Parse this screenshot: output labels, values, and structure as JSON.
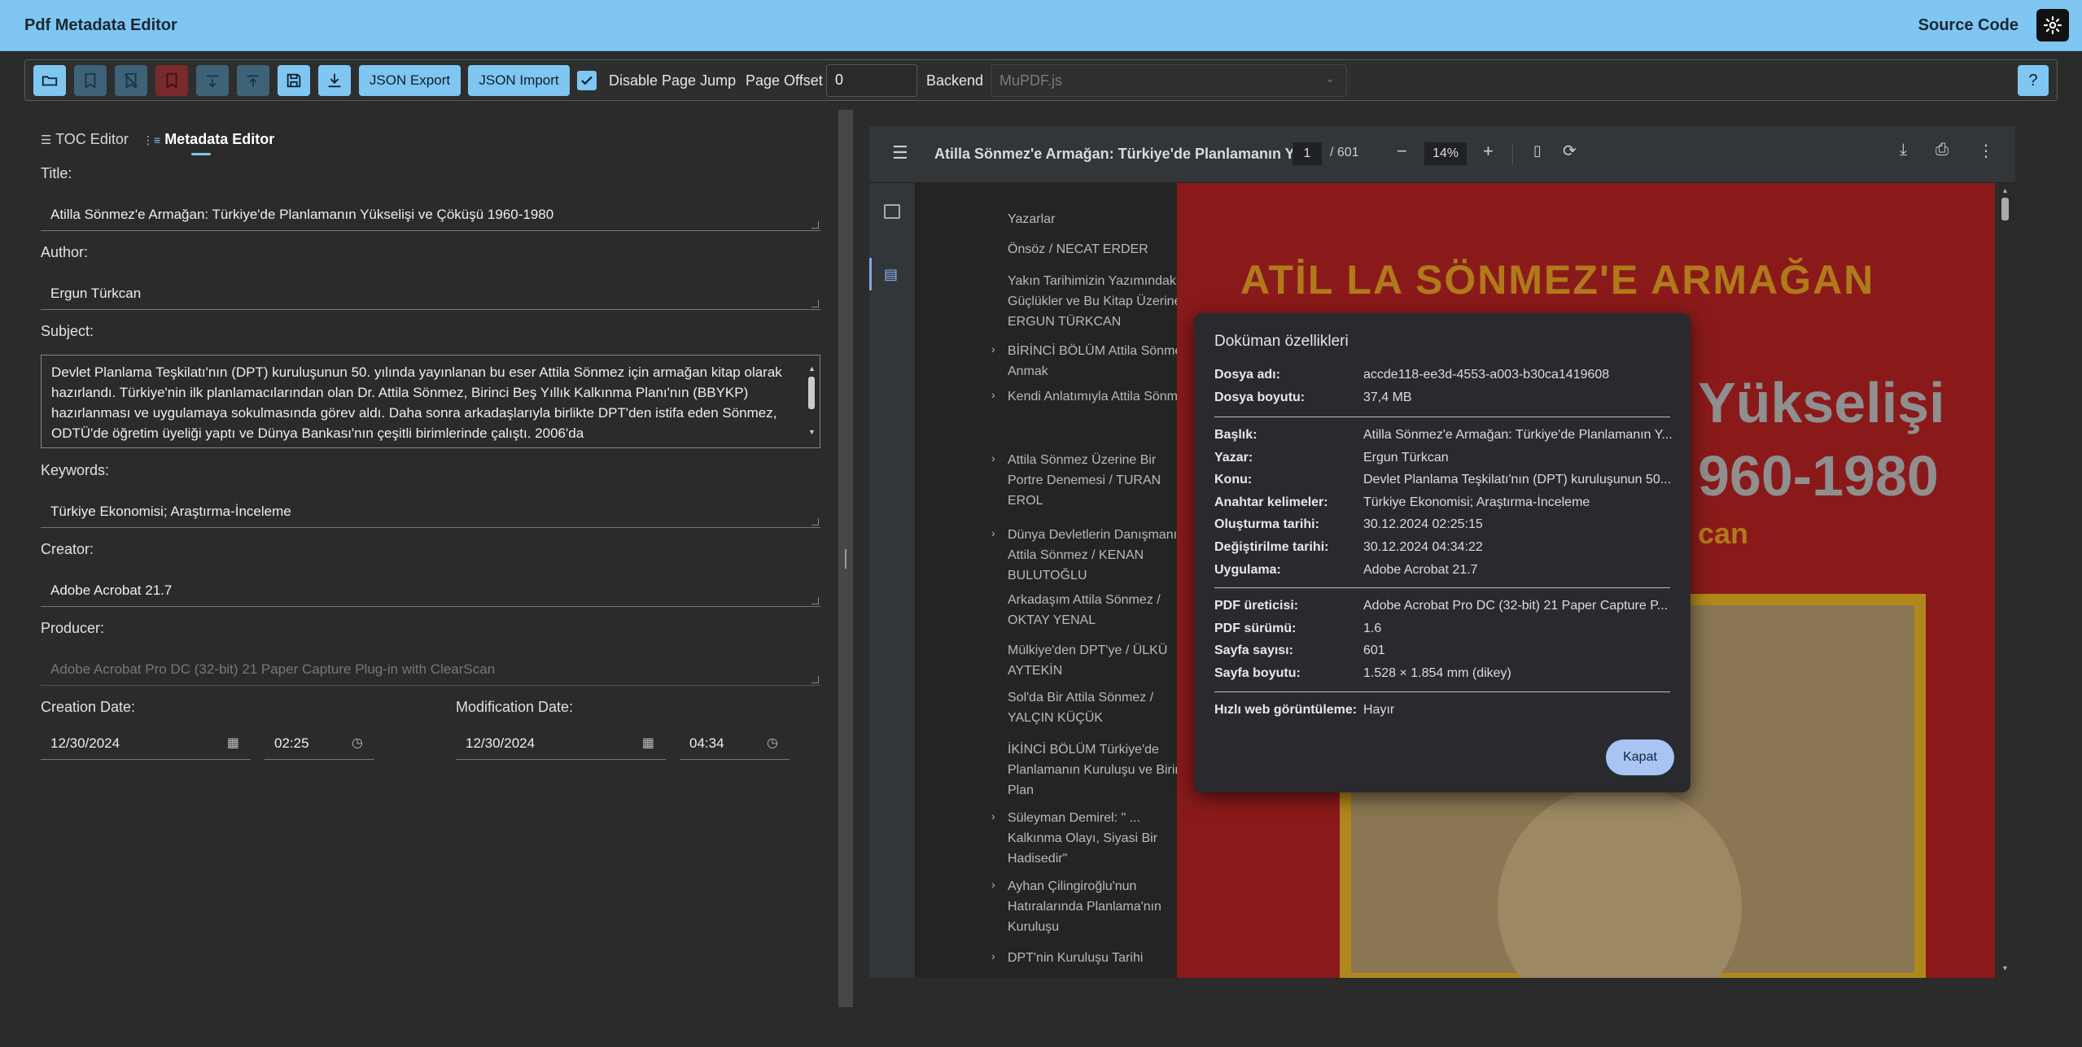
{
  "app": {
    "title": "Pdf Metadata Editor",
    "source_code": "Source Code"
  },
  "toolbar": {
    "json_export": "JSON Export",
    "json_import": "JSON Import",
    "disable_page_jump": "Disable Page Jump",
    "page_offset_label": "Page Offset",
    "page_offset_value": "0",
    "backend_label": "Backend",
    "backend_value": "MuPDF.js",
    "help": "?"
  },
  "tabs": {
    "toc": "TOC Editor",
    "metadata": "Metadata Editor"
  },
  "form": {
    "title_label": "Title:",
    "title_value": "Atilla Sönmez'e Armağan: Türkiye'de Planlamanın Yükselişi ve Çöküşü 1960-1980",
    "author_label": "Author:",
    "author_value": "Ergun Türkcan",
    "subject_label": "Subject:",
    "subject_value": "Devlet Planlama Teşkilatı'nın (DPT) kuruluşunun 50. yılında yayınlanan bu eser Attila Sönmez için armağan kitap olarak hazırlandı. Türkiye'nin ilk planlamacılarından olan Dr. Attila Sönmez, Birinci Beş Yıllık Kalkınma Planı'nın (BBYKP) hazırlanması ve uygulamaya sokulmasında görev aldı. Daha sonra arkadaşlarıyla birlikte DPT'den istifa eden Sönmez, ODTÜ'de öğretim üyeliği yaptı ve Dünya Bankası'nın çeşitli birimlerinde çalıştı. 2006'da",
    "keywords_label": "Keywords:",
    "keywords_value": "Türkiye Ekonomisi; Araştırma-İnceleme",
    "creator_label": "Creator:",
    "creator_value": "Adobe Acrobat 21.7",
    "producer_label": "Producer:",
    "producer_value": "Adobe Acrobat Pro DC (32-bit) 21 Paper Capture Plug-in with ClearScan",
    "creation_label": "Creation Date:",
    "creation_date": "12/30/2024",
    "creation_time": "02:25",
    "modification_label": "Modification Date:",
    "modification_date": "12/30/2024",
    "modification_time": "04:34"
  },
  "viewer": {
    "title": "Atilla Sönmez'e Armağan: Türkiye'de Planlamanın Y...",
    "page": "1",
    "total": "/ 601",
    "zoom": "14%",
    "outline": [
      {
        "label": "Yazarlar",
        "chevron": false
      },
      {
        "label": "Önsöz / NECAT ERDER",
        "chevron": false
      },
      {
        "label": "Yakın Tarihimizin Yazımındaki Güçlükler ve Bu Kitap Üzerine / ERGUN TÜRKCAN",
        "chevron": false
      },
      {
        "label": "BİRİNCİ BÖLÜM Attila Sönmez'i Anmak",
        "chevron": true
      },
      {
        "label": "Kendi Anlatımıyla Attila Sönmez",
        "chevron": true
      },
      {
        "label": "Attila Sönmez Üzerine Bir Portre Denemesi / TURAN EROL",
        "chevron": true
      },
      {
        "label": "Dünya Devletlerin Danışmanı: Attila Sönmez / KENAN BULUTOĞLU",
        "chevron": true
      },
      {
        "label": "Arkadaşım Attila Sönmez / OKTAY YENAL",
        "chevron": false
      },
      {
        "label": "Mülkiye'den DPT'ye / ÜLKÜ AYTEKİN",
        "chevron": false
      },
      {
        "label": "Sol'da Bir Attila Sönmez / YALÇIN KÜÇÜK",
        "chevron": false
      },
      {
        "label": "İKİNCİ BÖLÜM Türkiye'de Planlamanın Kuruluşu ve Birinci Plan",
        "chevron": false
      },
      {
        "label": "Süleyman Demirel: \" ... Kalkınma Olayı, Siyasi Bir Hadisedir\"",
        "chevron": true
      },
      {
        "label": "Ayhan Çilingiroğlu'nun Hatıralarında Planlama'nın Kuruluşu",
        "chevron": true
      },
      {
        "label": "DPT'nin Kuruluşu Tarihi",
        "chevron": true
      }
    ],
    "pdf_title": "ATİL LA SÖNMEZ'E ARMAĞAN",
    "pdf_word1": "Yükselişi",
    "pdf_word2": "960-1980",
    "pdf_word3": "can"
  },
  "dialog": {
    "title": "Doküman özellikleri",
    "group1": [
      {
        "k": "Dosya adı:",
        "v": "accde118-ee3d-4553-a003-b30ca1419608"
      },
      {
        "k": "Dosya boyutu:",
        "v": "37,4 MB"
      }
    ],
    "group2": [
      {
        "k": "Başlık:",
        "v": "Atilla Sönmez'e Armağan: Türkiye'de Planlamanın Y..."
      },
      {
        "k": "Yazar:",
        "v": "Ergun Türkcan"
      },
      {
        "k": "Konu:",
        "v": "Devlet Planlama Teşkilatı'nın (DPT) kuruluşunun 50..."
      },
      {
        "k": "Anahtar kelimeler:",
        "v": "Türkiye Ekonomisi; Araştırma-İnceleme"
      },
      {
        "k": "Oluşturma tarihi:",
        "v": "30.12.2024 02:25:15"
      },
      {
        "k": "Değiştirilme tarihi:",
        "v": "30.12.2024 04:34:22"
      },
      {
        "k": "Uygulama:",
        "v": "Adobe Acrobat 21.7"
      }
    ],
    "group3": [
      {
        "k": "PDF üreticisi:",
        "v": "Adobe Acrobat Pro DC (32-bit) 21 Paper Capture P..."
      },
      {
        "k": "PDF sürümü:",
        "v": "1.6"
      },
      {
        "k": "Sayfa sayısı:",
        "v": "601"
      },
      {
        "k": "Sayfa boyutu:",
        "v": "1.528 × 1.854 mm (dikey)"
      }
    ],
    "group4": [
      {
        "k": "Hızlı web görüntüleme:",
        "v": "Hayır"
      }
    ],
    "close": "Kapat"
  }
}
